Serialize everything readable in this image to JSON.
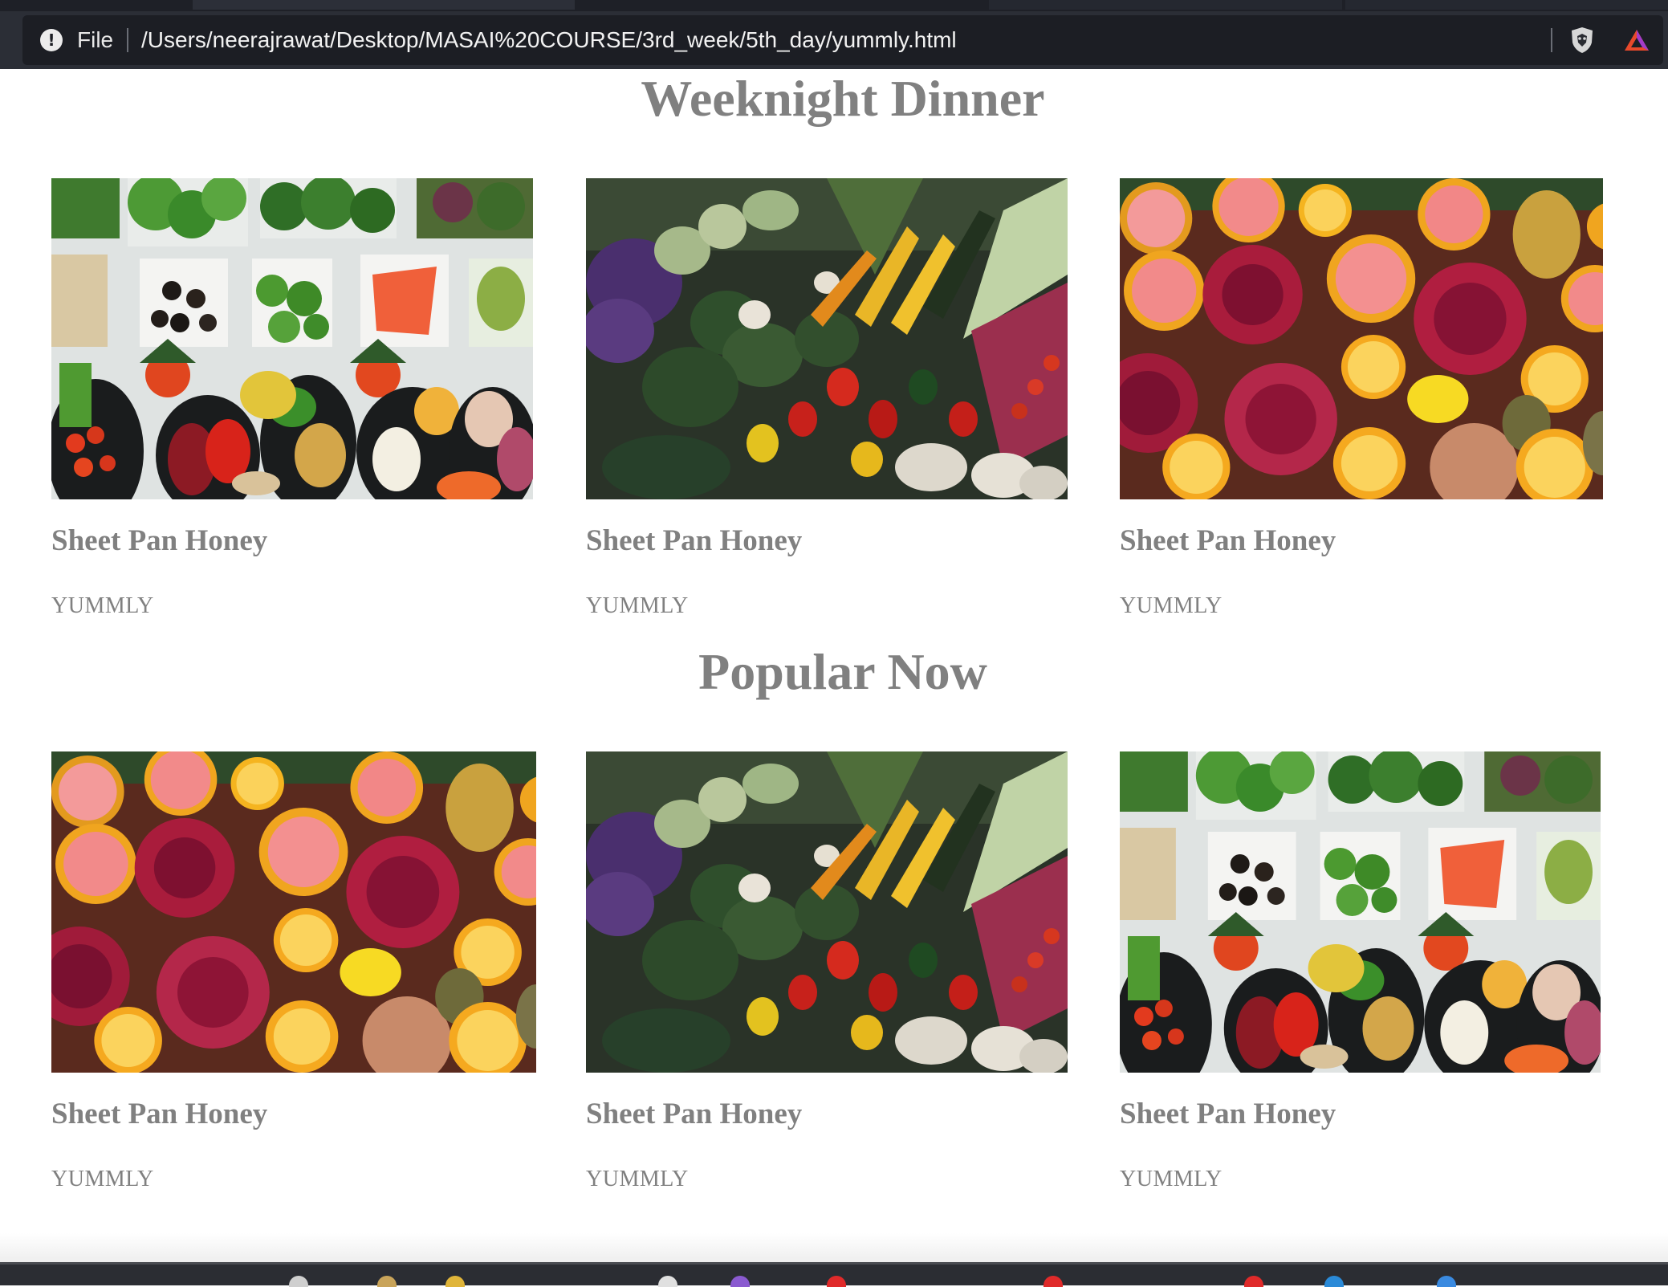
{
  "browser": {
    "scheme_label": "File",
    "url": "/Users/neerajrawat/Desktop/MASAI%20COURSE/3rd_week/5th_day/yummly.html",
    "icons": [
      "info-icon",
      "brave-shield-icon",
      "brave-rewards-icon"
    ]
  },
  "sections": [
    {
      "title": "Weeknight Dinner",
      "cards": [
        {
          "name": "Sheet Pan Honey",
          "brand": "YUMMLY",
          "image": "salad-bar-photo"
        },
        {
          "name": "Sheet Pan Honey",
          "brand": "YUMMLY",
          "image": "vegetable-market-photo"
        },
        {
          "name": "Sheet Pan Honey",
          "brand": "YUMMLY",
          "image": "citrus-pomegranate-photo"
        }
      ]
    },
    {
      "title": "Popular Now",
      "cards": [
        {
          "name": "Sheet Pan Honey",
          "brand": "YUMMLY",
          "image": "citrus-pomegranate-photo"
        },
        {
          "name": "Sheet Pan Honey",
          "brand": "YUMMLY",
          "image": "vegetable-market-photo"
        },
        {
          "name": "Sheet Pan Honey",
          "brand": "YUMMLY",
          "image": "salad-bar-photo"
        }
      ]
    }
  ],
  "colors": {
    "text_gray": "#808080",
    "chrome_dark": "#2b2e36",
    "urlbar_bg": "#1c1e24"
  }
}
